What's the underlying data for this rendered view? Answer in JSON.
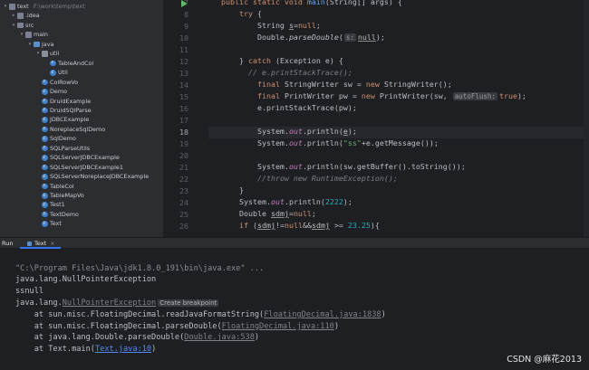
{
  "tree": {
    "items": [
      {
        "label": "text",
        "hint": "F:\\work\\temp\\text",
        "depth": 0,
        "icon": "folder",
        "arrow": "▾"
      },
      {
        "label": ".idea",
        "hint": "",
        "depth": 1,
        "icon": "folder",
        "arrow": "▸"
      },
      {
        "label": "src",
        "hint": "",
        "depth": 1,
        "icon": "folder",
        "arrow": "▾"
      },
      {
        "label": "main",
        "hint": "",
        "depth": 2,
        "icon": "folder",
        "arrow": "▾"
      },
      {
        "label": "java",
        "hint": "",
        "depth": 3,
        "icon": "src",
        "arrow": "▾"
      },
      {
        "label": "util",
        "hint": "",
        "depth": 4,
        "icon": "pkg",
        "arrow": "▾"
      },
      {
        "label": "TableAndCol",
        "hint": "",
        "depth": 5,
        "icon": "cls",
        "arrow": ""
      },
      {
        "label": "Util",
        "hint": "",
        "depth": 5,
        "icon": "cls",
        "arrow": ""
      },
      {
        "label": "ColRowVo",
        "hint": "",
        "depth": 4,
        "icon": "cls",
        "arrow": ""
      },
      {
        "label": "Demo",
        "hint": "",
        "depth": 4,
        "icon": "cls",
        "arrow": ""
      },
      {
        "label": "DruidExample",
        "hint": "",
        "depth": 4,
        "icon": "cls",
        "arrow": ""
      },
      {
        "label": "DruidSQlParse",
        "hint": "",
        "depth": 4,
        "icon": "cls",
        "arrow": ""
      },
      {
        "label": "JDBCExample",
        "hint": "",
        "depth": 4,
        "icon": "cls",
        "arrow": ""
      },
      {
        "label": "NoreplaceSqlDemo",
        "hint": "",
        "depth": 4,
        "icon": "cls",
        "arrow": ""
      },
      {
        "label": "SqlDemo",
        "hint": "",
        "depth": 4,
        "icon": "cls",
        "arrow": ""
      },
      {
        "label": "SQLParseUtils",
        "hint": "",
        "depth": 4,
        "icon": "cls",
        "arrow": ""
      },
      {
        "label": "SQLServerJDBCExample",
        "hint": "",
        "depth": 4,
        "icon": "cls",
        "arrow": ""
      },
      {
        "label": "SQLServerJDBCExample1",
        "hint": "",
        "depth": 4,
        "icon": "cls",
        "arrow": ""
      },
      {
        "label": "SQLServerNoreplaceJDBCExample",
        "hint": "",
        "depth": 4,
        "icon": "cls",
        "arrow": ""
      },
      {
        "label": "TableCol",
        "hint": "",
        "depth": 4,
        "icon": "cls",
        "arrow": ""
      },
      {
        "label": "TableMapVo",
        "hint": "",
        "depth": 4,
        "icon": "cls",
        "arrow": ""
      },
      {
        "label": "Test1",
        "hint": "",
        "depth": 4,
        "icon": "cls",
        "arrow": ""
      },
      {
        "label": "TextDemo",
        "hint": "",
        "depth": 4,
        "icon": "cls",
        "arrow": ""
      },
      {
        "label": "Text",
        "hint": "",
        "depth": 4,
        "icon": "cls",
        "arrow": ""
      }
    ]
  },
  "editor": {
    "current_line": "18",
    "lines": [
      {
        "n": "7",
        "tokens": [
          [
            "kw",
            "public static void "
          ],
          [
            "fn",
            "main"
          ],
          [
            "",
            "(String[] args) {"
          ]
        ]
      },
      {
        "n": "8",
        "tokens": [
          [
            "",
            "    "
          ],
          [
            "kw",
            "try"
          ],
          [
            "",
            " {"
          ]
        ]
      },
      {
        "n": "9",
        "tokens": [
          [
            "",
            "        String "
          ],
          [
            "ul",
            "s"
          ],
          [
            "",
            "="
          ],
          [
            "kw",
            "null"
          ],
          [
            "",
            ";"
          ]
        ]
      },
      {
        "n": "10",
        "tokens": [
          [
            "",
            "        Double."
          ],
          [
            "it",
            "parseDouble"
          ],
          [
            "",
            "("
          ],
          [
            "hint",
            "s:"
          ],
          [
            "ul",
            "null"
          ],
          [
            "",
            ");"
          ]
        ]
      },
      {
        "n": "11",
        "tokens": []
      },
      {
        "n": "12",
        "tokens": [
          [
            "",
            "    } "
          ],
          [
            "kw",
            "catch"
          ],
          [
            "",
            " (Exception e) {"
          ]
        ]
      },
      {
        "n": "13",
        "tokens": [
          [
            "",
            "      "
          ],
          [
            "cm",
            "// e.printStackTrace();"
          ]
        ]
      },
      {
        "n": "14",
        "tokens": [
          [
            "",
            "        "
          ],
          [
            "kw",
            "final "
          ],
          [
            "",
            "StringWriter sw = "
          ],
          [
            "kw",
            "new "
          ],
          [
            "",
            "StringWriter();"
          ]
        ]
      },
      {
        "n": "15",
        "tokens": [
          [
            "",
            "        "
          ],
          [
            "kw",
            "final "
          ],
          [
            "",
            "PrintWriter pw = "
          ],
          [
            "kw",
            "new "
          ],
          [
            "",
            "PrintWriter(sw, "
          ],
          [
            "hint",
            "autoFlush:"
          ],
          [
            "kw",
            "true"
          ],
          [
            "",
            ");"
          ]
        ]
      },
      {
        "n": "16",
        "tokens": [
          [
            "",
            "        e.printStackTrace(pw);"
          ]
        ]
      },
      {
        "n": "17",
        "tokens": []
      },
      {
        "n": "18",
        "tokens": [
          [
            "",
            "        System."
          ],
          [
            "fld",
            "out"
          ],
          [
            "",
            ".println("
          ],
          [
            "ul",
            "e"
          ],
          [
            "",
            ");"
          ]
        ]
      },
      {
        "n": "19",
        "tokens": [
          [
            "",
            "        System."
          ],
          [
            "fld",
            "out"
          ],
          [
            "",
            ".println("
          ],
          [
            "st",
            "\"ss\""
          ],
          [
            "",
            "+e.getMessage());"
          ]
        ]
      },
      {
        "n": "20",
        "tokens": []
      },
      {
        "n": "21",
        "tokens": [
          [
            "",
            "        System."
          ],
          [
            "fld",
            "out"
          ],
          [
            "",
            ".println(sw.getBuffer().toString());"
          ]
        ]
      },
      {
        "n": "22",
        "tokens": [
          [
            "",
            "        "
          ],
          [
            "cm",
            "//throw new RuntimeException();"
          ]
        ]
      },
      {
        "n": "23",
        "tokens": [
          [
            "",
            "    }"
          ]
        ]
      },
      {
        "n": "24",
        "tokens": [
          [
            "",
            "    System."
          ],
          [
            "fld",
            "out"
          ],
          [
            "",
            ".println("
          ],
          [
            "nm",
            "2222"
          ],
          [
            "",
            ");"
          ]
        ]
      },
      {
        "n": "25",
        "tokens": [
          [
            "",
            "    Double "
          ],
          [
            "ul",
            "sdmj"
          ],
          [
            "",
            "="
          ],
          [
            "kw",
            "null"
          ],
          [
            "",
            ";"
          ]
        ]
      },
      {
        "n": "26",
        "tokens": [
          [
            "",
            "    "
          ],
          [
            "kw",
            "if "
          ],
          [
            "",
            "("
          ],
          [
            "ul",
            "sdmj"
          ],
          [
            "",
            "!="
          ],
          [
            "kw",
            "null"
          ],
          [
            "",
            "&&"
          ],
          [
            "ul",
            "sdmj"
          ],
          [
            "",
            " >= "
          ],
          [
            "nm",
            "23.25"
          ],
          [
            "",
            "){"
          ]
        ]
      }
    ]
  },
  "run_panel": {
    "label": "Run",
    "tab_label": "Text",
    "tab_close": "×"
  },
  "console": {
    "cmd": "\"C:\\Program Files\\Java\\jdk1.8.0_191\\bin\\java.exe\" ...",
    "line1": "java.lang.NullPointerException",
    "line2": "ssnull",
    "line3_prefix": "java.lang.",
    "line3_link": "NullPointerException",
    "breakpoint_label": "Create breakpoint",
    "stack": [
      {
        "prefix": "    at sun.misc.FloatingDecimal.readJavaFormatString(",
        "link": "FloatingDecimal.java:1838",
        "suffix": ")",
        "grey": true
      },
      {
        "prefix": "    at sun.misc.FloatingDecimal.parseDouble(",
        "link": "FloatingDecimal.java:110",
        "suffix": ")",
        "grey": true
      },
      {
        "prefix": "    at java.lang.Double.parseDouble(",
        "link": "Double.java:538",
        "suffix": ")",
        "grey": true
      },
      {
        "prefix": "    at Text.main(",
        "link": "Text.java:10",
        "suffix": ")",
        "grey": false
      }
    ]
  },
  "watermark": "CSDN @麻花2013"
}
